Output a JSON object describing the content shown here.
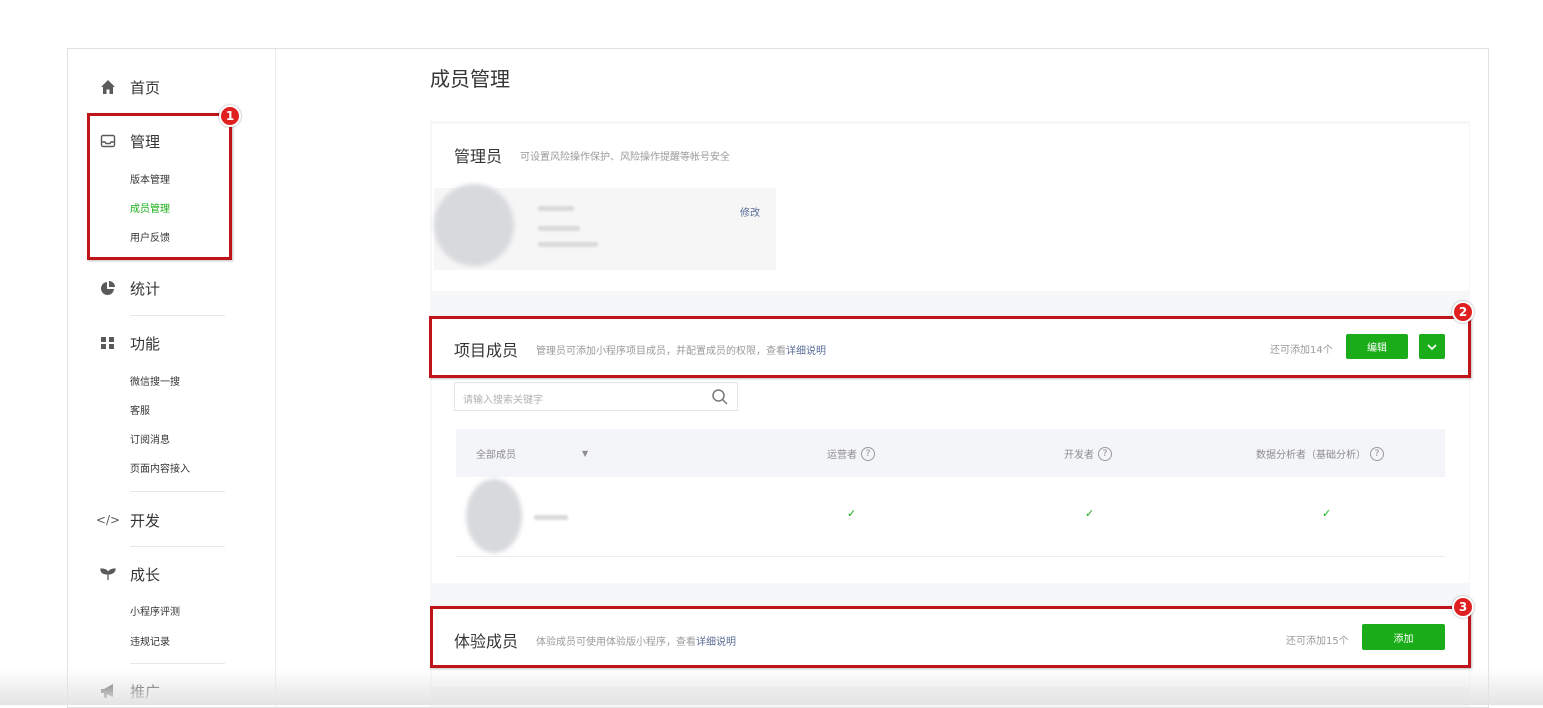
{
  "sidebar": {
    "home": {
      "icon": "home-icon",
      "label": "首页"
    },
    "manage": {
      "icon": "inbox-icon",
      "label": "管理",
      "items": [
        "版本管理",
        "成员管理",
        "用户反馈"
      ],
      "active_index": 1
    },
    "stats": {
      "icon": "pie-chart-icon",
      "label": "统计"
    },
    "features": {
      "icon": "grid-icon",
      "label": "功能",
      "items": [
        "微信搜一搜",
        "客服",
        "订阅消息",
        "页面内容接入"
      ]
    },
    "develop": {
      "icon": "code-icon",
      "label": "开发"
    },
    "growth": {
      "icon": "sprout-icon",
      "label": "成长",
      "items": [
        "小程序评测",
        "违规记录"
      ]
    },
    "promote": {
      "icon": "megaphone-icon",
      "label": "推广"
    }
  },
  "page_title": "成员管理",
  "admin": {
    "title": "管理员",
    "desc": "可设置风险操作保护、风险操作提醒等帐号安全",
    "edit_label": "修改"
  },
  "project_members": {
    "title": "项目成员",
    "desc": "管理员可添加小程序项目成员，并配置成员的权限，查看",
    "desc_link": "详细说明",
    "remaining": "还可添加14个",
    "edit_button": "编辑",
    "search_placeholder": "请输入搜索关键字",
    "filter_label": "全部成员",
    "columns": [
      "运营者",
      "开发者",
      "数据分析者（基础分析）"
    ],
    "rows": [
      {
        "checks": [
          "✓",
          "✓",
          "✓"
        ]
      }
    ]
  },
  "trial_members": {
    "title": "体验成员",
    "desc": "体验成员可使用体验版小程序，查看",
    "desc_link": "详细说明",
    "remaining": "还可添加15个",
    "add_button": "添加"
  },
  "annotations": [
    "1",
    "2",
    "3"
  ],
  "colors": {
    "accent": "#1aad19",
    "highlight": "#c0141b",
    "link": "#576b95"
  }
}
